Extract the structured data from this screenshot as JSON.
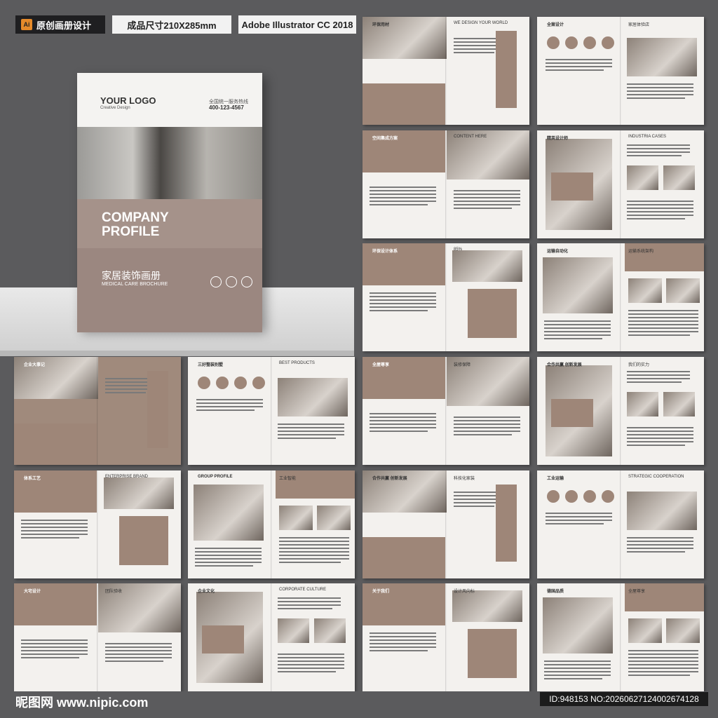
{
  "header_tags": {
    "ai_icon": "Ai",
    "tag1": "原创画册设计",
    "tag2": "成品尺寸210X285mm",
    "tag3": "Adobe Illustrator CC 2018"
  },
  "cover": {
    "logo": "YOUR LOGO",
    "logo_sub": "Creative Design",
    "hotline_label": "全国统一服务热线",
    "hotline": "400-123-4567",
    "title1": "COMPANY",
    "title2": "PROFILE",
    "cn_title": "家居装饰画册",
    "en_sub": "MEDICAL CARE BROCHURE"
  },
  "spreads": [
    {
      "title": "环保用材",
      "sub": "WE DESIGN YOUR WORLD"
    },
    {
      "title": "全案设计",
      "sub": "家居体验店"
    },
    {
      "title": "空间集成方案",
      "sub": "CONTENT HERE"
    },
    {
      "title": "精英设计师",
      "sub": "INDUSTRIA CASES"
    },
    {
      "title": "环保设计体系",
      "sub": "85%"
    },
    {
      "title": "运输自动化",
      "sub": "运输系统架构"
    },
    {
      "title": "企业大事记",
      "sub": ""
    },
    {
      "title": "三好整装别墅",
      "sub": "BEST PRODUCTS"
    },
    {
      "title": "全屋尊享",
      "sub": "装修保障"
    },
    {
      "title": "合作共赢 创新发展",
      "sub": "我们的实力"
    },
    {
      "title": "体系工艺",
      "sub": "ENTERPRISE BRAND"
    },
    {
      "title": "GROUP PROFILE",
      "sub": "工业智能"
    },
    {
      "title": "合作共赢 创新发展",
      "sub": "科技化家装"
    },
    {
      "title": "工业运输",
      "sub": "STRATEGIC COOPERATION"
    },
    {
      "title": "大宅设计",
      "sub": "团队验收"
    },
    {
      "title": "企业文化",
      "sub": "CORPORATE CULTURE"
    },
    {
      "title": "关于我们",
      "sub": "设计风向标"
    },
    {
      "title": "德国品质",
      "sub": "全屋尊享"
    }
  ],
  "footer": {
    "watermark": "昵图网 www.nipic.com",
    "id": "ID:948153 NO:20260627124002674128"
  }
}
